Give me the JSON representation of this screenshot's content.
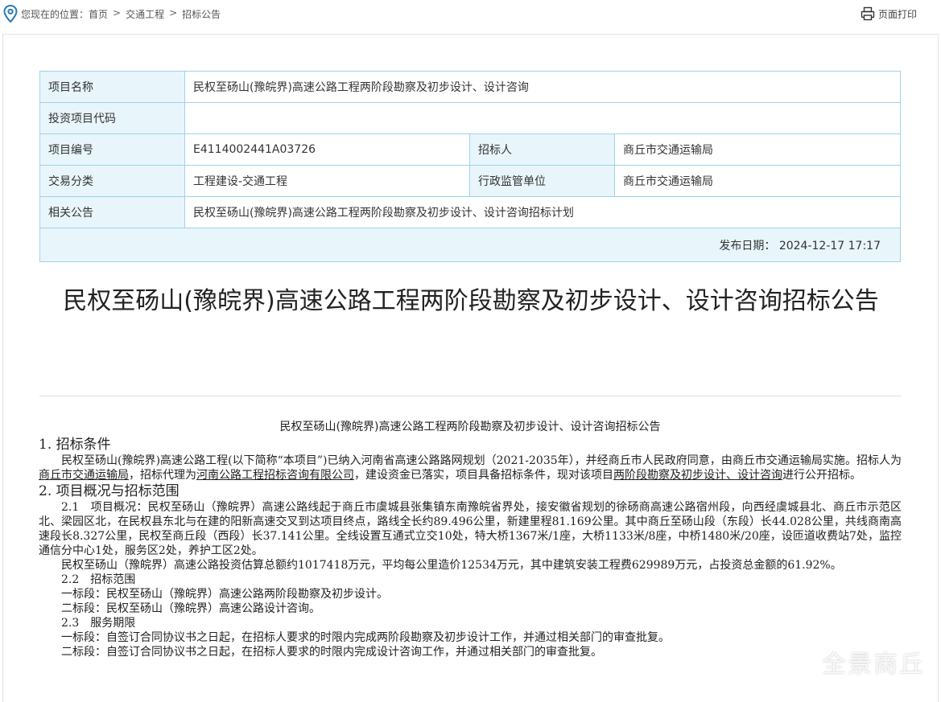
{
  "breadcrumb": {
    "prefix": "您现在的位置：",
    "items": [
      "首页",
      "交通工程",
      "招标公告"
    ],
    "separator": ">"
  },
  "print_label": "页面打印",
  "info": {
    "project_name_label": "项目名称",
    "project_name": "民权至砀山(豫皖界)高速公路工程两阶段勘察及初步设计、设计咨询",
    "invest_code_label": "投资项目代码",
    "invest_code": "",
    "project_no_label": "项目编号",
    "project_no": "E4114002441A03726",
    "tenderer_label": "招标人",
    "tenderer": "商丘市交通运输局",
    "category_label": "交易分类",
    "category": "工程建设-交通工程",
    "supervisor_label": "行政监管单位",
    "supervisor": "商丘市交通运输局",
    "related_label": "相关公告",
    "related": "民权至砀山(豫皖界)高速公路工程两阶段勘察及初步设计、设计咨询招标计划",
    "publish": "发布日期： 2024-12-17 17:17"
  },
  "title": "民权至砀山(豫皖界)高速公路工程两阶段勘察及初步设计、设计咨询招标公告",
  "doc": {
    "subtitle": "民权至砀山(豫皖界)高速公路工程两阶段勘察及初步设计、设计咨询招标公告",
    "s1_heading": "1. 招标条件",
    "s1_a": "民权至砀山(豫皖界)高速公路工程(以下简称“本项目”)已纳入河南省高速公路路网规划（2021-2035年），并经商丘市人民政府同意，由商丘市交通运输局实施。招标人为",
    "s1_link1": "商丘市交通运输局",
    "s1_b": "，招标代理为",
    "s1_link2": "河南公路工程招标咨询有限公司",
    "s1_c": "，建设资金已落实，项目具备招标条件，现对该项目",
    "s1_link3": "两阶段勘察及初步设计、设计咨询",
    "s1_d": "进行公开招标。",
    "s2_heading": "2. 项目概况与招标范围",
    "s21": "2.1　项目概况：民权至砀山（豫皖界）高速公路线起于商丘市虞城县张集镇东南豫皖省界处，接安徽省规划的徐砀商高速公路宿州段，向西经虞城县北、商丘市示范区北、梁园区北，在民权县东北与在建的阳新高速交叉到达项目终点，路线全长约89.496公里，新建里程81.169公里。其中商丘至砀山段（东段）长44.028公里，共线商南高速段长8.327公里，民权至商丘段（西段）长37.141公里。全线设置互通式立交10处，特大桥1367米/1座，大桥1133米/8座，中桥1480米/20座，设匝道收费站7处，监控通信分中心1处，服务区2处，养护工区2处。",
    "s21b": "民权至砀山（豫皖界）高速公路投资估算总额约1017418万元，平均每公里造价12534万元，其中建筑安装工程费629989万元，占投资总金额的61.92%。",
    "s22": "2.2　招标范围",
    "s22a": "一标段：民权至砀山（豫皖界）高速公路两阶段勘察及初步设计。",
    "s22b": "二标段：民权至砀山（豫皖界）高速公路设计咨询。",
    "s23": "2.3　服务期限",
    "s23a": "一标段：自签订合同协议书之日起，在招标人要求的时限内完成两阶段勘察及初步设计工作，并通过相关部门的审查批复。",
    "s23b": "二标段：自签订合同协议书之日起，在招标人要求的时限内完成设计咨询工作，并通过相关部门的审查批复。"
  },
  "watermark": "全景商丘"
}
